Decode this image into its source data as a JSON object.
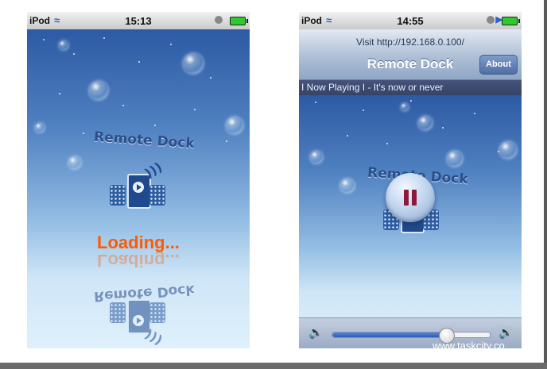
{
  "left_phone": {
    "status": {
      "carrier": "iPod",
      "time": "15:13"
    },
    "brand": "Remote Dock",
    "loading_text": "Loading..."
  },
  "right_phone": {
    "status": {
      "carrier": "iPod",
      "time": "14:55"
    },
    "navbar": {
      "visit_text": "Visit http://192.168.0.100/",
      "title": "Remote Dock",
      "about_label": "About"
    },
    "now_playing": "I Now Playing I - It's now or never",
    "brand": "Remote Dock",
    "volume_level": 0.72,
    "watermark": "www.taskcity.co"
  },
  "icons": [
    "wifi-icon",
    "battery-icon",
    "lock-icon",
    "play-status-icon",
    "dock-logo-icon",
    "pause-icon",
    "volume-min-icon",
    "volume-max-icon"
  ]
}
